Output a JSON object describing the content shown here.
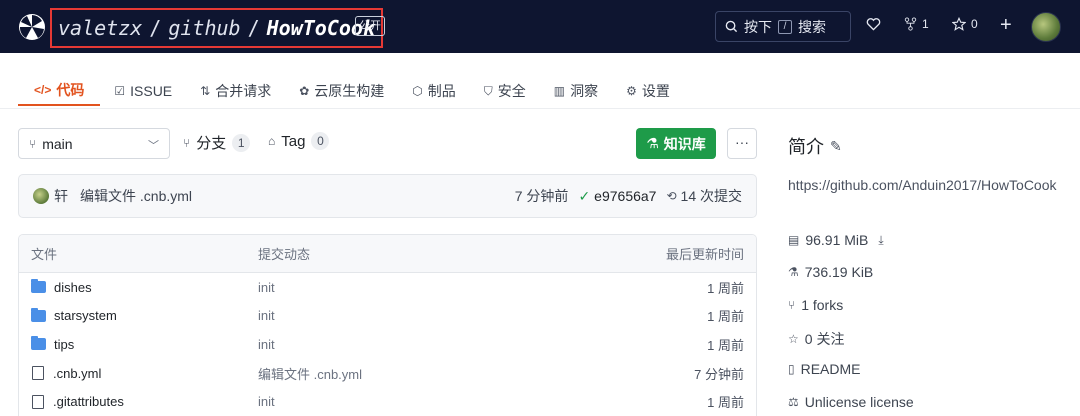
{
  "header": {
    "owner": "valetzx",
    "group": "github",
    "repo": "HowToCook",
    "visibility": "公开",
    "search_label": "按下",
    "search_key": "/",
    "search_action": "搜索",
    "fork_count": "1",
    "star_count": "0",
    "add_icon": "plus-icon"
  },
  "tabs": [
    {
      "label": "代码",
      "icon": "code-icon",
      "active": true
    },
    {
      "label": "ISSUE",
      "icon": "issue-icon"
    },
    {
      "label": "合并请求",
      "icon": "pull-request-icon"
    },
    {
      "label": "云原生构建",
      "icon": "build-icon"
    },
    {
      "label": "制品",
      "icon": "package-icon"
    },
    {
      "label": "安全",
      "icon": "shield-icon"
    },
    {
      "label": "洞察",
      "icon": "insight-icon"
    },
    {
      "label": "设置",
      "icon": "gear-icon"
    }
  ],
  "branch": {
    "current": "main",
    "branches_label": "分支",
    "branches_count": "1",
    "tags_label": "Tag",
    "tags_count": "0",
    "knowledge_button": "知识库",
    "more_button": "···"
  },
  "commit": {
    "author": "轩",
    "message": "编辑文件 .cnb.yml",
    "time": "7 分钟前",
    "hash": "e97656a7",
    "total": "14 次提交"
  },
  "files": {
    "headers": [
      "文件",
      "提交动态",
      "最后更新时间"
    ],
    "rows": [
      {
        "name": "dishes",
        "type": "folder",
        "commit": "init",
        "time": "1 周前"
      },
      {
        "name": "starsystem",
        "type": "folder",
        "commit": "init",
        "time": "1 周前"
      },
      {
        "name": "tips",
        "type": "folder",
        "commit": "init",
        "time": "1 周前"
      },
      {
        "name": ".cnb.yml",
        "type": "file",
        "commit": "编辑文件 .cnb.yml",
        "time": "7 分钟前"
      },
      {
        "name": ".gitattributes",
        "type": "file",
        "commit": "init",
        "time": "1 周前"
      }
    ]
  },
  "sidebar": {
    "title": "简介",
    "url": "https://github.com/Anduin2017/HowToCook",
    "size": "96.91 MiB",
    "lfs": "736.19 KiB",
    "forks": "1 forks",
    "stars": "0 关注",
    "readme": "README",
    "license": "Unlicense license"
  },
  "colors": {
    "header_bg": "#0e1530",
    "accent": "#e2531f",
    "primary_button": "#1e9b49",
    "highlight_box": "#e53935"
  }
}
